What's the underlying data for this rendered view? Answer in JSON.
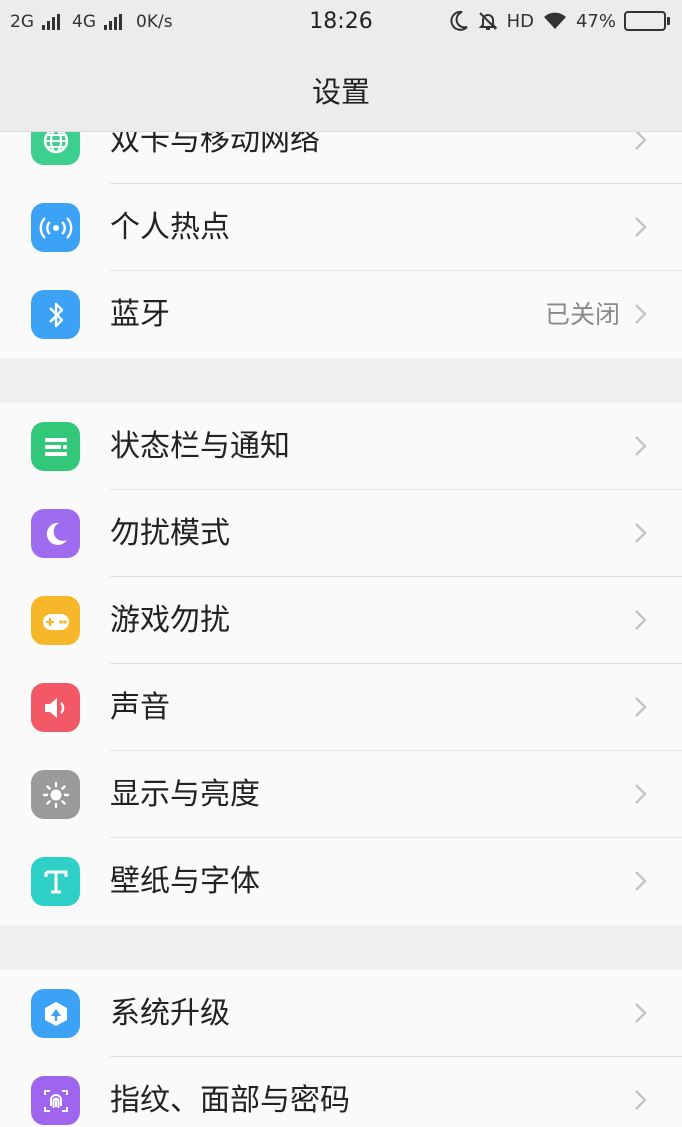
{
  "status_bar": {
    "sim1": "2G",
    "sim2": "4G",
    "speed": "0K/s",
    "time": "18:26",
    "hd": "HD",
    "battery_text": "47%",
    "battery_level": 0.47
  },
  "header": {
    "title": "设置"
  },
  "groups": [
    {
      "items": [
        {
          "label": "双卡与移动网络",
          "icon": "globe-icon",
          "color": "#3ccf8e"
        },
        {
          "label": "个人热点",
          "icon": "hotspot-icon",
          "color": "#3ba2f6"
        },
        {
          "label": "蓝牙",
          "icon": "bluetooth-icon",
          "color": "#3ba2f6",
          "value": "已关闭"
        }
      ]
    },
    {
      "items": [
        {
          "label": "状态栏与通知",
          "icon": "status-bar-icon",
          "color": "#33c779"
        },
        {
          "label": "勿扰模式",
          "icon": "moon-icon",
          "color": "#9f6cf0"
        },
        {
          "label": "游戏勿扰",
          "icon": "gamepad-icon",
          "color": "#f6b72a"
        },
        {
          "label": "声音",
          "icon": "speaker-icon",
          "color": "#f25865"
        },
        {
          "label": "显示与亮度",
          "icon": "sun-icon",
          "color": "#9a9a9a"
        },
        {
          "label": "壁纸与字体",
          "icon": "font-icon",
          "color": "#2fd0c8"
        }
      ]
    },
    {
      "items": [
        {
          "label": "系统升级",
          "icon": "system-update-icon",
          "color": "#3ba2f6"
        },
        {
          "label": "指纹、面部与密码",
          "icon": "fingerprint-icon",
          "color": "#a065ee"
        }
      ]
    }
  ]
}
